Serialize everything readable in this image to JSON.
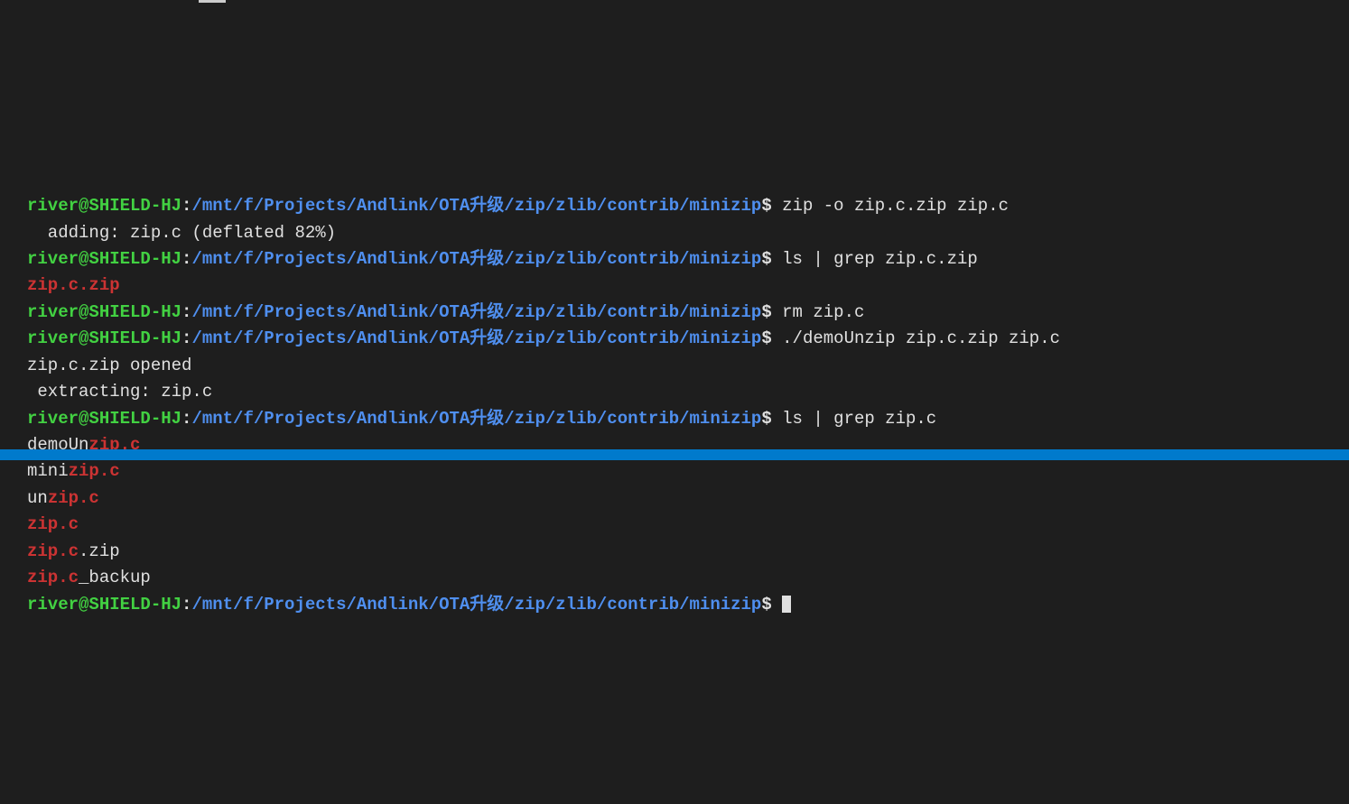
{
  "prompt": {
    "user_host": "river@SHIELD-HJ",
    "colon": ":",
    "path": "/mnt/f/Projects/Andlink/OTA升级/zip/zlib/contrib/minizip",
    "dollar": "$"
  },
  "lines": [
    {
      "type": "prompt",
      "cmd": " zip -o zip.c.zip zip.c"
    },
    {
      "type": "output",
      "text": "  adding: zip.c (deflated 82%)"
    },
    {
      "type": "prompt",
      "cmd": " ls | grep zip.c.zip"
    },
    {
      "type": "highlight_full",
      "text": "zip.c.zip"
    },
    {
      "type": "prompt",
      "cmd": " rm zip.c"
    },
    {
      "type": "prompt",
      "cmd": " ./demoUnzip zip.c.zip zip.c"
    },
    {
      "type": "output",
      "text": "zip.c.zip opened"
    },
    {
      "type": "output",
      "text": " extracting: zip.c"
    },
    {
      "type": "prompt",
      "cmd": " ls | grep zip.c"
    },
    {
      "type": "mixed",
      "prefix": "demoUn",
      "highlight": "zip.c",
      "suffix": ""
    },
    {
      "type": "mixed",
      "prefix": "mini",
      "highlight": "zip.c",
      "suffix": ""
    },
    {
      "type": "mixed",
      "prefix": "un",
      "highlight": "zip.c",
      "suffix": ""
    },
    {
      "type": "mixed",
      "prefix": "",
      "highlight": "zip.c",
      "suffix": ""
    },
    {
      "type": "mixed",
      "prefix": "",
      "highlight": "zip.c",
      "suffix": ".zip"
    },
    {
      "type": "mixed",
      "prefix": "",
      "highlight": "zip.c",
      "suffix": "_backup"
    },
    {
      "type": "prompt_cursor",
      "cmd": " "
    }
  ]
}
